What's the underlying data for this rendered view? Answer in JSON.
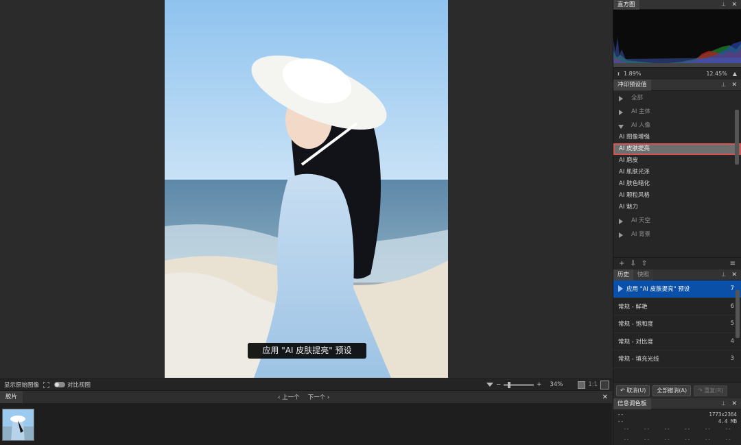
{
  "viewer": {
    "overlay_message": "应用 \"AI 皮肤提亮\" 预设",
    "show_original_label": "显示原始图像",
    "compare_view_label": "对比视图",
    "zoom_percent": "34%",
    "one_to_one": "1:1"
  },
  "filmstrip": {
    "tab": "胶片",
    "prev": "上一个",
    "next": "下一个",
    "close": "✕"
  },
  "histogram": {
    "tab": "直方图",
    "left_value": "1.89%",
    "right_value": "12.45%"
  },
  "presets": {
    "tab": "冲印预设值",
    "groups_top": [
      {
        "label": "全部",
        "open": false
      },
      {
        "label": "AI 主体",
        "open": false
      },
      {
        "label": "AI 人像",
        "open": true
      }
    ],
    "items": [
      {
        "label": "AI 图像增强",
        "selected": false
      },
      {
        "label": "AI 皮肤提亮",
        "selected": true
      },
      {
        "label": "AI 磨皮",
        "selected": false
      },
      {
        "label": "AI 肌肤光泽",
        "selected": false
      },
      {
        "label": "AI 肤色暗化",
        "selected": false
      },
      {
        "label": "AI 颗粒风格",
        "selected": false
      },
      {
        "label": "AI 魅力",
        "selected": false
      }
    ],
    "groups_bottom": [
      {
        "label": "AI 天空",
        "open": false
      },
      {
        "label": "AI 背景",
        "open": false
      }
    ]
  },
  "history": {
    "tabs": [
      "历史",
      "快照"
    ],
    "rows": [
      {
        "label": "应用 \"AI 皮肤提亮\" 预设",
        "num": "7",
        "active": true
      },
      {
        "label": "常规 - 鲜艳",
        "num": "6",
        "active": false
      },
      {
        "label": "常规 - 饱和度",
        "num": "5",
        "active": false
      },
      {
        "label": "常规 - 对比度",
        "num": "4",
        "active": false
      },
      {
        "label": "常规 - 填充光线",
        "num": "3",
        "active": false
      }
    ],
    "undo": "取消(U)",
    "undo_all": "全部撤消(A)",
    "redo": "重复(R)"
  },
  "info": {
    "tab": "信息调色板",
    "dash": "--",
    "dimensions": "1773x2364",
    "size": "4.4 MB"
  },
  "colors": {
    "accent_blue": "#0a4fa8",
    "selection_outline": "#d9534f"
  }
}
